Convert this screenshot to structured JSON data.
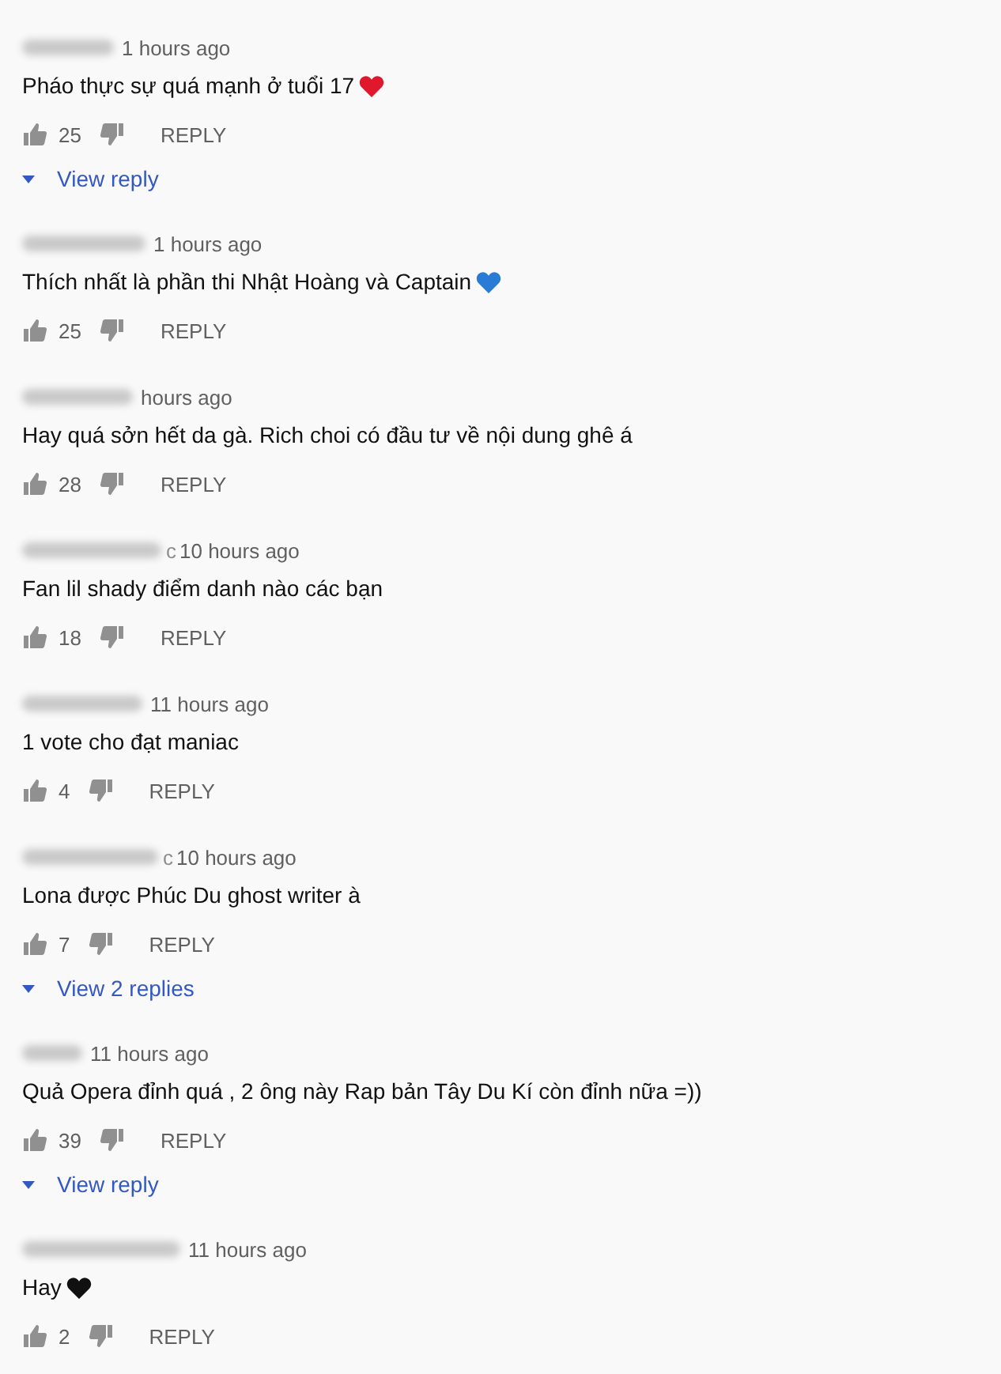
{
  "comments": [
    {
      "time": "1 hours ago",
      "text": "Pháo thực sự quá mạnh ở tuổi 17",
      "heart": {
        "color": "#e0182d"
      },
      "likes": "25",
      "reply": "REPLY",
      "view_replies": "View reply"
    },
    {
      "time": "1 hours ago",
      "text": "Thích nhất là phần thi Nhật Hoàng và Captain",
      "heart": {
        "color": "#2a7bd6"
      },
      "likes": "25",
      "reply": "REPLY"
    },
    {
      "time": "hours ago",
      "text": "Hay quá sởn hết da gà. Rich choi có đầu tư về nội dung ghê á",
      "likes": "28",
      "reply": "REPLY"
    },
    {
      "author_tail": "c",
      "time": "10 hours ago",
      "text": "Fan lil shady điểm danh nào các bạn",
      "likes": "18",
      "reply": "REPLY"
    },
    {
      "time": "11 hours ago",
      "text": "1 vote cho đạt maniac",
      "likes": "4",
      "reply": "REPLY"
    },
    {
      "author_tail": "c",
      "time": "10 hours ago",
      "text": "Lona được Phúc Du ghost writer à",
      "likes": "7",
      "reply": "REPLY",
      "view_replies": "View 2 replies"
    },
    {
      "time": "11 hours ago",
      "text": "Quả Opera đỉnh quá , 2 ông này Rap bản Tây Du Kí còn đỉnh nữa =))",
      "likes": "39",
      "reply": "REPLY",
      "view_replies": "View reply"
    },
    {
      "time": "11 hours ago",
      "text": "Hay",
      "heart": {
        "color": "#111111"
      },
      "likes": "2",
      "reply": "REPLY"
    }
  ]
}
